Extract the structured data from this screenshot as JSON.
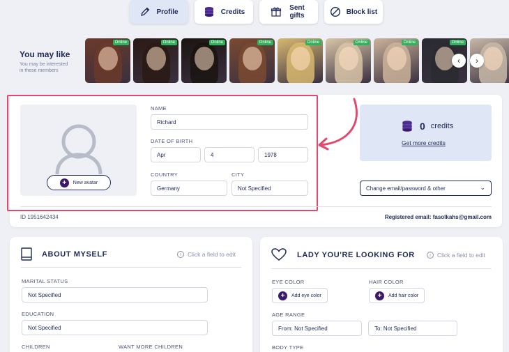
{
  "tabs": [
    {
      "label": "Profile",
      "icon": "pencil-icon"
    },
    {
      "label": "Credits",
      "icon": "coins-icon"
    },
    {
      "label": "Sent gifts",
      "icon": "gift-icon"
    },
    {
      "label": "Block list",
      "icon": "block-icon"
    }
  ],
  "may_like": {
    "title": "You may like",
    "subtitle": "You may be interested in these members",
    "photos": [
      {
        "badge": "Online",
        "color": "#6b3a2a"
      },
      {
        "badge": "Online",
        "color": "#2a1a14"
      },
      {
        "badge": "Online",
        "color": "#1a1410"
      },
      {
        "badge": "Online",
        "color": "#7a4a30"
      },
      {
        "badge": "Online",
        "color": "#d8b870"
      },
      {
        "badge": "Online",
        "color": "#d9c6a8"
      },
      {
        "badge": "Online",
        "color": "#cbb39a"
      },
      {
        "badge": "Online",
        "color": "#2a2a30"
      },
      {
        "badge": "",
        "color": "#c8b8a8"
      }
    ]
  },
  "profile": {
    "new_avatar_label": "New avatar",
    "name_label": "NAME",
    "name_value": "Richard",
    "dob_label": "DATE OF BIRTH",
    "dob_month": "Apr",
    "dob_day": "4",
    "dob_year": "1978",
    "country_label": "COUNTRY",
    "country_value": "Germany",
    "city_label": "CITY",
    "city_value": "Not Specified",
    "credits_count": "0",
    "credits_word": "credits",
    "get_more": "Get more credits",
    "change_label": "Change email/password & other",
    "id_text": "ID 1951642434",
    "registered_email": "Registered email: fasolkahs@gmail.com"
  },
  "about": {
    "title": "ABOUT MYSELF",
    "click_hint": "Click a field to edit",
    "marital_label": "MARITAL STATUS",
    "marital_value": "Not Specified",
    "education_label": "EDUCATION",
    "education_value": "Not Specified",
    "children_label": "CHILDREN",
    "want_children_label": "WANT MORE CHILDREN"
  },
  "lady": {
    "title": "LADY YOU'RE LOOKING FOR",
    "click_hint": "Click a field to edit",
    "eye_label": "EYE COLOR",
    "eye_add": "Add eye color",
    "hair_label": "HAIR COLOR",
    "hair_add": "Add hair color",
    "age_label": "AGE RANGE",
    "age_from": "From: Not Specified",
    "age_to": "To: Not Specified",
    "body_label": "BODY TYPE"
  },
  "colors": {
    "accent": "#1f2a5a",
    "highlight": "#e3476d",
    "online": "#2fb25b",
    "plus": "#3b1a6b"
  }
}
